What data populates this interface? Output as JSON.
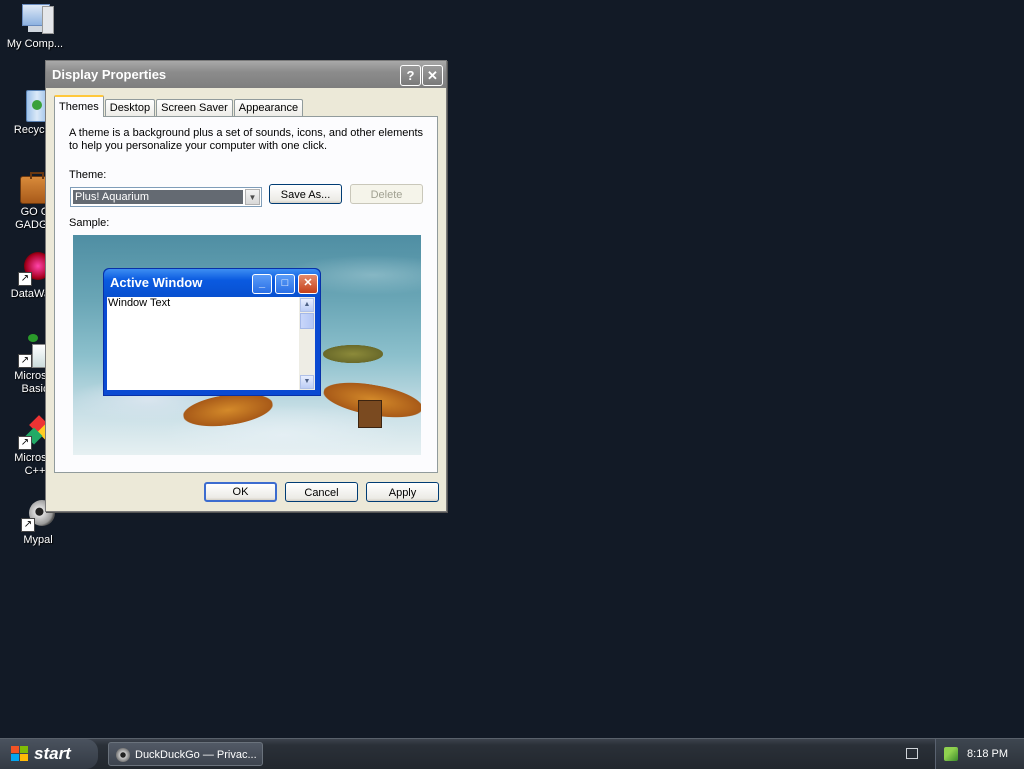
{
  "desktop": {
    "icons": [
      {
        "label": "My Comp..."
      },
      {
        "label": "Recycl..."
      },
      {
        "label": "GO G\nGADGE"
      },
      {
        "label": "DataWa..."
      },
      {
        "label": "Microsof\nBasic"
      },
      {
        "label": "Microsof\nC++"
      },
      {
        "label": "Mypal"
      }
    ]
  },
  "dialog": {
    "title": "Display Properties",
    "help_button": "?",
    "close_button": "✕",
    "tabs": [
      "Themes",
      "Desktop",
      "Screen Saver",
      "Appearance"
    ],
    "active_tab": "Themes",
    "description": "A theme is a background plus a set of sounds, icons, and other elements to help you personalize your computer with one click.",
    "theme_label": "Theme:",
    "theme_value": "Plus! Aquarium",
    "save_as_label": "Save As...",
    "delete_label": "Delete",
    "sample_label": "Sample:",
    "preview": {
      "window_title": "Active Window",
      "window_text": "Window Text"
    },
    "ok_label": "OK",
    "cancel_label": "Cancel",
    "apply_label": "Apply"
  },
  "taskbar": {
    "start_label": "start",
    "task_button_label": "DuckDuckGo — Privac...",
    "clock": "8:18 PM"
  },
  "colors": {
    "desktop_bg": "#121a26",
    "dialog_face": "#ece9d8",
    "preview_title": "#0a5ae0"
  }
}
